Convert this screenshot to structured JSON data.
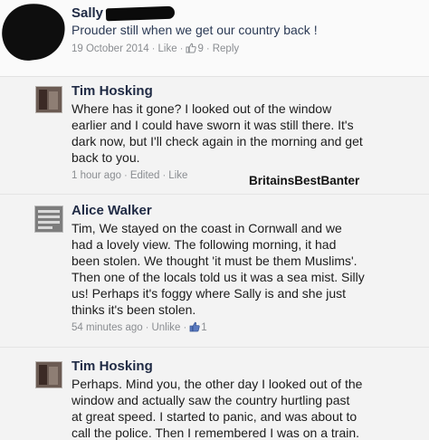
{
  "top_post": {
    "author": "Sally",
    "text": "Prouder still when we get our country back !",
    "date": "19 October 2014",
    "like": "Like",
    "likes": "9",
    "reply": "Reply"
  },
  "comments": [
    {
      "author": "Tim Hosking",
      "lines": [
        "Where has it gone? I looked out of the window",
        "earlier and I could have sworn it was still there. It's",
        "dark now, but I'll check again in the morning and get",
        "back to you."
      ],
      "time": "1 hour ago",
      "edited": "Edited",
      "like": "Like"
    },
    {
      "author": "Alice Walker",
      "lines": [
        "Tim,  We stayed on the coast in Cornwall and we",
        "had a lovely view. The following morning, it had",
        "been stolen. We thought 'it must be them Muslims'.",
        "Then one of the locals told us it was a sea mist. Silly",
        "us! Perhaps it's foggy where Sally is and she just",
        "thinks it's been stolen."
      ],
      "time": "54 minutes ago",
      "unlike": "Unlike",
      "likes": "1"
    },
    {
      "author": "Tim Hosking",
      "lines": [
        "Perhaps. Mind you, the other day I looked out of the",
        "window and actually saw the country hurtling past",
        "at great speed. I started to panic, and was about to",
        "call the police. Then I remembered I was on a train."
      ]
    }
  ],
  "watermark": "BritainsBestBanter",
  "colors": {
    "name": "#1f2a44",
    "meta": "#8a8d91",
    "like_blue": "#3b5998"
  },
  "icons": [
    "thumbs-up-icon",
    "redacted-avatar",
    "profile-avatar"
  ]
}
